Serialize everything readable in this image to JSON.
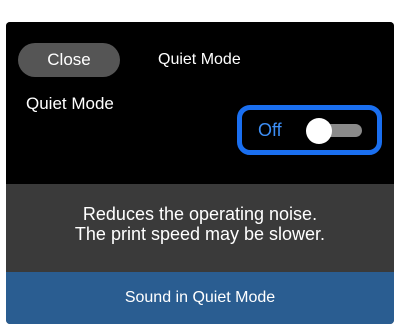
{
  "header": {
    "close_label": "Close",
    "title": "Quiet Mode"
  },
  "setting": {
    "label": "Quiet Mode",
    "state_label": "Off",
    "enabled": false
  },
  "description": {
    "line1": "Reduces the operating noise.",
    "line2": "The print speed may be slower."
  },
  "footer": {
    "label": "Sound in Quiet Mode"
  },
  "colors": {
    "screen_bg": "#000000",
    "panel_bg": "#3a3a3a",
    "highlight_border": "#1a6ff0",
    "state_text": "#3d8ef5",
    "footer_bg": "#2a5d91",
    "close_button_bg": "#555555"
  }
}
